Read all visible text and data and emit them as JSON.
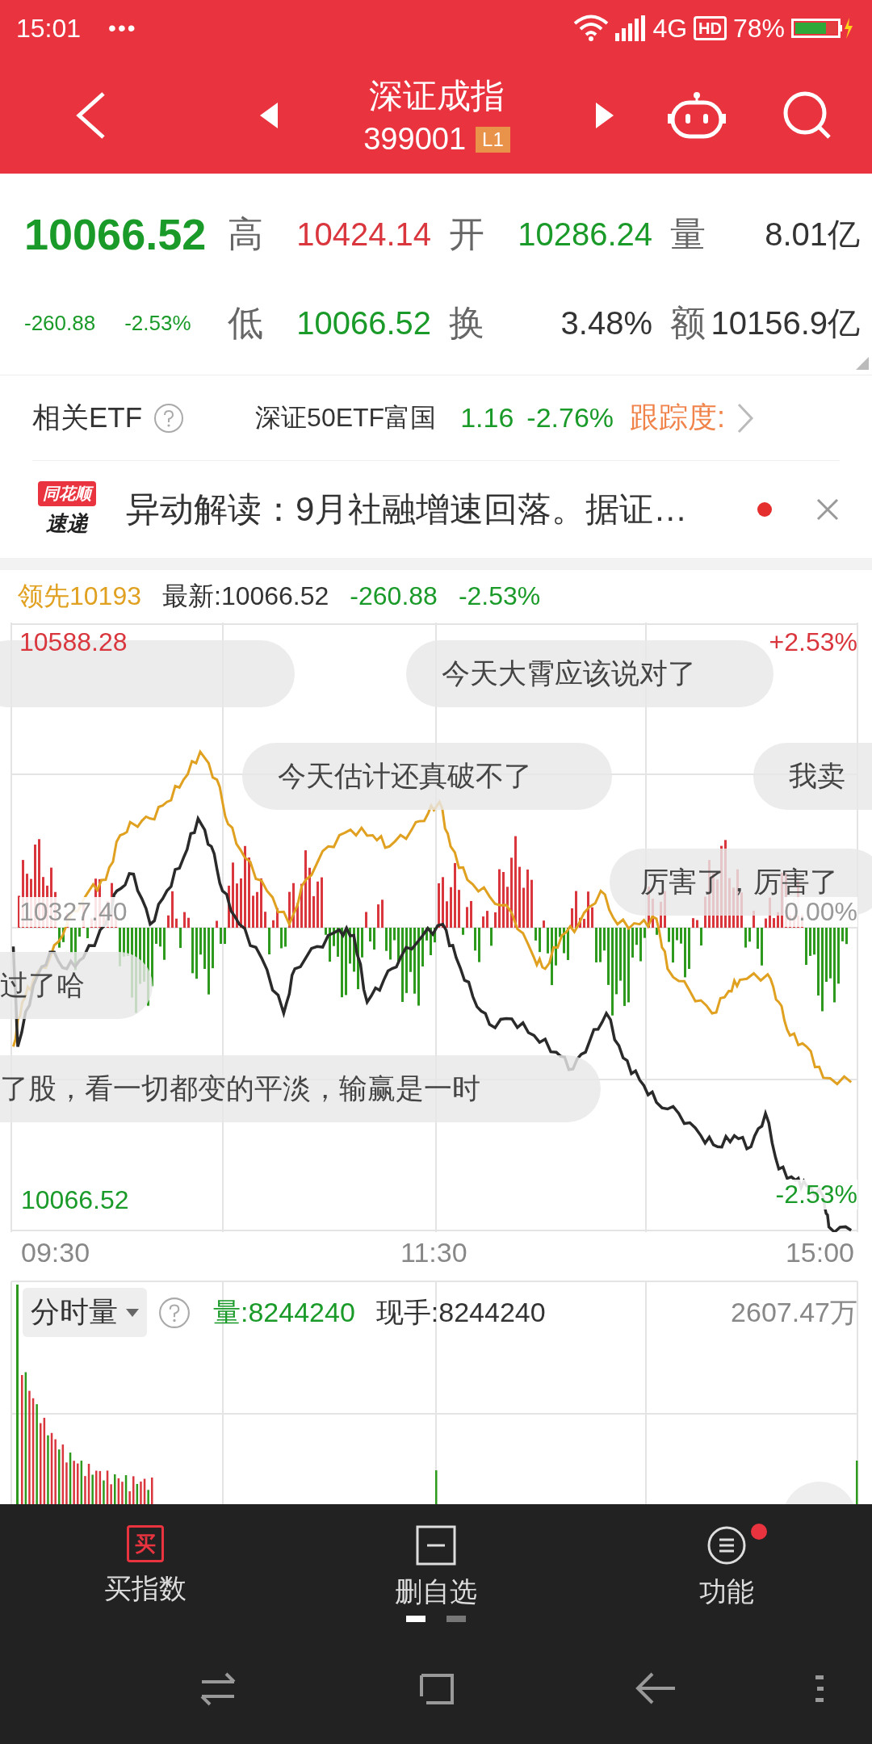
{
  "status_bar": {
    "time": "15:01",
    "dots": "•••",
    "network": "4G",
    "hd": "HD",
    "battery": "78%"
  },
  "header": {
    "title": "深证成指",
    "code": "399001",
    "badge": "L1"
  },
  "quote": {
    "price": "10066.52",
    "change": "-260.88",
    "change_pct": "-2.53%",
    "stats": [
      {
        "label": "高",
        "value": "10424.14",
        "color": "#d9363e"
      },
      {
        "label": "开",
        "value": "10286.24",
        "color": "#1a9a28"
      },
      {
        "label": "量",
        "value": "8.01亿",
        "color": "#333333"
      },
      {
        "label": "低",
        "value": "10066.52",
        "color": "#1a9a28"
      },
      {
        "label": "换",
        "value": "3.48%",
        "color": "#333333"
      },
      {
        "label": "额",
        "value": "10156.9亿",
        "color": "#333333"
      }
    ]
  },
  "etf": {
    "label": "相关ETF",
    "name": "深证50ETF富国",
    "price": "1.16",
    "change": "-2.76%",
    "tracking": "跟踪度:"
  },
  "news": {
    "logo_top": "同花顺",
    "logo_bottom": "速递",
    "text": "异动解读：9月社融增速回落。据证…",
    "unread": true
  },
  "chart": {
    "legend": {
      "lead": "领先10193",
      "latest": "最新:10066.52",
      "change": "-260.88",
      "change_pct": "-2.53%"
    },
    "top_price": "10588.28",
    "top_pct": "+2.53%",
    "mid_price": "10327.40",
    "mid_pct": "0.00%",
    "bottom_price": "10066.52",
    "bottom_pct": "-2.53%",
    "times": [
      "09:30",
      "11:30",
      "15:00"
    ],
    "comments": [
      {
        "text": "今天大霄应该说对了"
      },
      {
        "text": "今天估计还真破不了"
      },
      {
        "text": "我卖"
      },
      {
        "text": "厉害了，厉害了"
      },
      {
        "text": "过了哈"
      },
      {
        "text": "了股，看一切都变的平淡，输赢是一时"
      }
    ]
  },
  "volume": {
    "selector": "分时量",
    "amount": "量:8244240",
    "current": "现手:8244240",
    "max": "2607.47万"
  },
  "toolbar": [
    {
      "kind": "buy",
      "icon_text": "买",
      "label": "买指数",
      "dot": false
    },
    {
      "kind": "remove",
      "label": "删自选",
      "dot": false
    },
    {
      "kind": "menu",
      "label": "功能",
      "dot": true
    }
  ],
  "pages": [
    {
      "selected": true
    },
    {
      "selected": false
    }
  ]
}
